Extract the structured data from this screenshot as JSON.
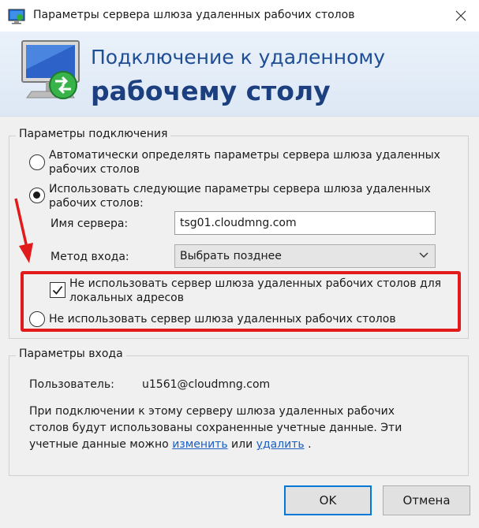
{
  "window": {
    "title": "Параметры сервера шлюза удаленных рабочих столов"
  },
  "banner": {
    "line1": "Подключение к удаленному",
    "line2": "рабочему столу"
  },
  "connection": {
    "legend": "Параметры подключения",
    "option_auto": {
      "line1": "Автоматически определять параметры сервера шлюза удаленных",
      "line2": "рабочих столов",
      "checked": false
    },
    "option_manual": {
      "line1": "Использовать следующие параметры сервера шлюза удаленных",
      "line2": "рабочих столов:",
      "checked": true
    },
    "server_label": "Имя сервера:",
    "server_value": "tsg01.cloudmng.com",
    "method_label": "Метод входа:",
    "method_value": "Выбрать позднее",
    "bypass_local": {
      "line1": "Не использовать сервер шлюза удаленных рабочих столов для",
      "line2": "локальных адресов",
      "checked": true
    },
    "option_none": {
      "label": "Не использовать сервер шлюза удаленных рабочих столов",
      "checked": false
    }
  },
  "logon": {
    "legend": "Параметры входа",
    "user_label": "Пользователь:",
    "user_value": "u1561@cloudmng.com",
    "desc_line1": "При подключении к этому серверу шлюза удаленных рабочих",
    "desc_line2": "столов будут использованы сохраненные учетные данные. Эти",
    "desc_line3_prefix": "учетные данные можно",
    "link_edit": "изменить",
    "desc_or": "или",
    "link_delete": "удалить",
    "desc_end": "."
  },
  "buttons": {
    "ok": "OK",
    "cancel": "Отмена"
  },
  "colors": {
    "highlight": "#e11b1b",
    "link": "#1b5fc0",
    "banner_text": "#1f4e96"
  }
}
